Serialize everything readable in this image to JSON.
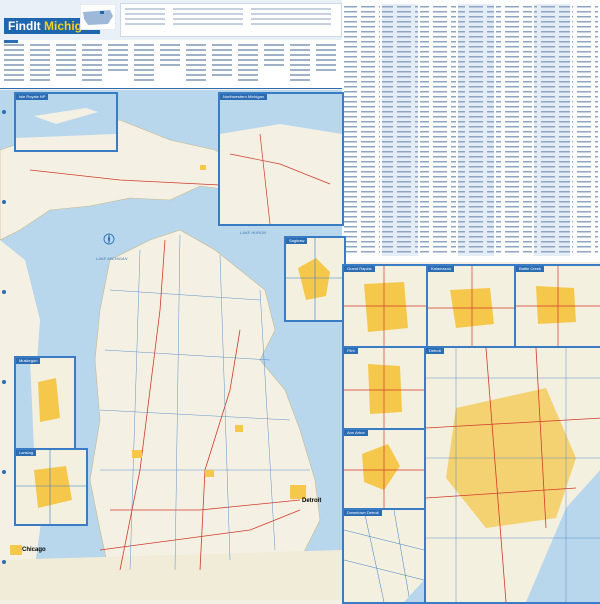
{
  "header": {
    "brand_find": "FindIt",
    "brand_state": "Michigan"
  },
  "map_labels": {
    "lake_superior": "LAKE SUPERIOR",
    "lake_michigan": "LAKE MICHIGAN",
    "lake_huron": "LAKE HURON",
    "chicago": "Chicago",
    "detroit": "Detroit"
  },
  "insets": {
    "isle_royale": "Isle Royale NP",
    "northwestern": "Northwestern Michigan",
    "saginaw": "Saginaw",
    "muskegon": "Muskegon",
    "lansing": "Lansing",
    "grand_rapids": "Grand Rapids",
    "kalamazoo": "Kalamazoo",
    "battle_creek": "Battle Creek",
    "flint": "Flint",
    "ann_arbor": "Ann Arbor",
    "downtown_detroit": "Downtown Detroit",
    "detroit": "Detroit"
  },
  "colors": {
    "water": "#b9d7ec",
    "land": "#f4f1e4",
    "urban": "#f5c84c",
    "border": "#3a7cc4",
    "road": "#d23a2a",
    "brand_blue": "#1f66b1"
  }
}
